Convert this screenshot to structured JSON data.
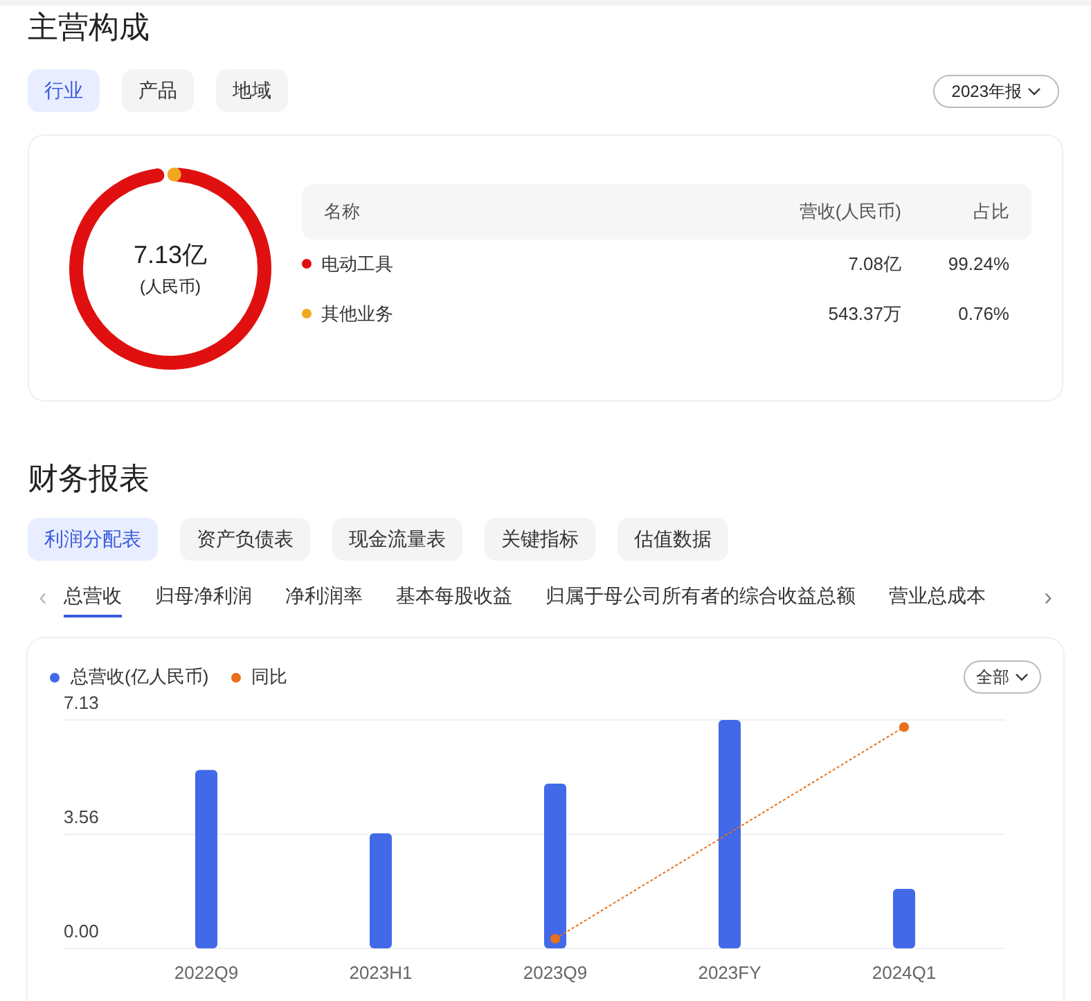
{
  "composition": {
    "title": "主营构成",
    "tabs": [
      {
        "label": "行业",
        "selected": true
      },
      {
        "label": "产品",
        "selected": false
      },
      {
        "label": "地域",
        "selected": false
      }
    ],
    "period_select": "2023年报",
    "donut": {
      "center_value": "7.13亿",
      "center_unit": "(人民币)"
    },
    "table": {
      "columns": [
        "名称",
        "营收(人民币)",
        "占比"
      ],
      "rows": [
        {
          "name": "电动工具",
          "revenue": "7.08亿",
          "share": "99.24%",
          "color": "#e01010"
        },
        {
          "name": "其他业务",
          "revenue": "543.37万",
          "share": "0.76%",
          "color": "#f0a820"
        }
      ]
    }
  },
  "financials": {
    "title": "财务报表",
    "tabs": [
      {
        "label": "利润分配表",
        "selected": true
      },
      {
        "label": "资产负债表",
        "selected": false
      },
      {
        "label": "现金流量表",
        "selected": false
      },
      {
        "label": "关键指标",
        "selected": false
      },
      {
        "label": "估值数据",
        "selected": false
      }
    ],
    "prev_arrow": "‹",
    "next_arrow": "›",
    "metrics": [
      {
        "label": "总营收",
        "selected": true
      },
      {
        "label": "归母净利润",
        "selected": false
      },
      {
        "label": "净利润率",
        "selected": false
      },
      {
        "label": "基本每股收益",
        "selected": false
      },
      {
        "label": "归属于母公司所有者的综合收益总额",
        "selected": false
      },
      {
        "label": "营业总成本",
        "selected": false
      }
    ],
    "range_select": "全部",
    "chart_data": {
      "type": "bar",
      "categories": [
        "2022Q9",
        "2023H1",
        "2023Q9",
        "2023FY",
        "2024Q1"
      ],
      "yticks": [
        {
          "value": 0,
          "label": "0.00"
        },
        {
          "value": 3.56,
          "label": "3.56"
        },
        {
          "value": 7.13,
          "label": "7.13"
        }
      ],
      "ylim": [
        0,
        7.13
      ],
      "legend": "top-left",
      "series": [
        {
          "name": "总营收(亿人民币)",
          "type": "bar",
          "color": "#4169e8",
          "values": [
            5.57,
            3.59,
            5.14,
            7.13,
            1.86
          ]
        },
        {
          "name": "同比",
          "type": "line",
          "line_style": "dashed",
          "marker": "circle",
          "color": "#e8701a",
          "values": [
            null,
            null,
            0.3,
            null,
            6.91
          ]
        }
      ]
    }
  }
}
